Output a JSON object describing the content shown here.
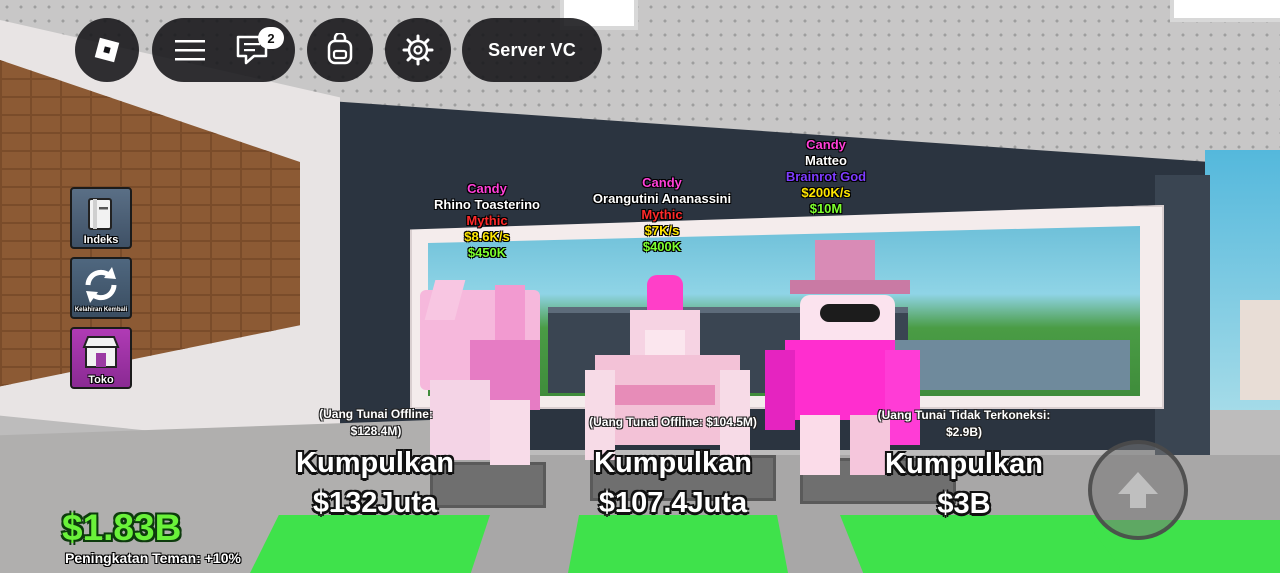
{
  "hud": {
    "server_button_label": "Server VC",
    "chat_badge_count": "2",
    "icons": [
      "roblox-logo-icon",
      "menu-icon",
      "chat-icon",
      "backpack-icon",
      "settings-icon"
    ]
  },
  "side_menu": {
    "index_label": "Indeks",
    "rebirth_label": "Kelahiran Kembali",
    "shop_label": "Toko"
  },
  "brainrots": [
    {
      "rarity_tag": "Candy",
      "name": "Rhino Toasterino",
      "tier": "Mythic",
      "income": "$8.6K/s",
      "price": "$450K",
      "offline_line1": "(Uang Tunai Offline:",
      "offline_line2": "$128.4M)",
      "collect_line1": "Kumpulkan",
      "collect_line2": "$132Juta"
    },
    {
      "rarity_tag": "Candy",
      "name": "Orangutini Ananassini",
      "tier": "Mythic",
      "income": "$7K/s",
      "price": "$400K",
      "offline_line1": "(Uang Tunai Offline: $104.5M)",
      "offline_line2": "",
      "collect_line1": "Kumpulkan",
      "collect_line2": "$107.4Juta"
    },
    {
      "rarity_tag": "Candy",
      "name": "Matteo",
      "tier": "Brainrot God",
      "income": "$200K/s",
      "price": "$10M",
      "offline_line1": "(Uang Tunai Tidak Terkoneksi:",
      "offline_line2": "$2.9B)",
      "collect_line1": "Kumpulkan",
      "collect_line2": "$3B"
    }
  ],
  "player": {
    "cash": "$1.83B",
    "friend_boost": "Peningkatan Teman: +10%"
  },
  "colors": {
    "candy": "#ff3fd8",
    "mythic": "#ff2a2a",
    "brainrot_god": "#7d3cff",
    "income": "#ffe600",
    "price": "#7dff2e",
    "cash": "#6af23a",
    "pad_green": "#3fe24b",
    "hud_dark": "#141418"
  }
}
